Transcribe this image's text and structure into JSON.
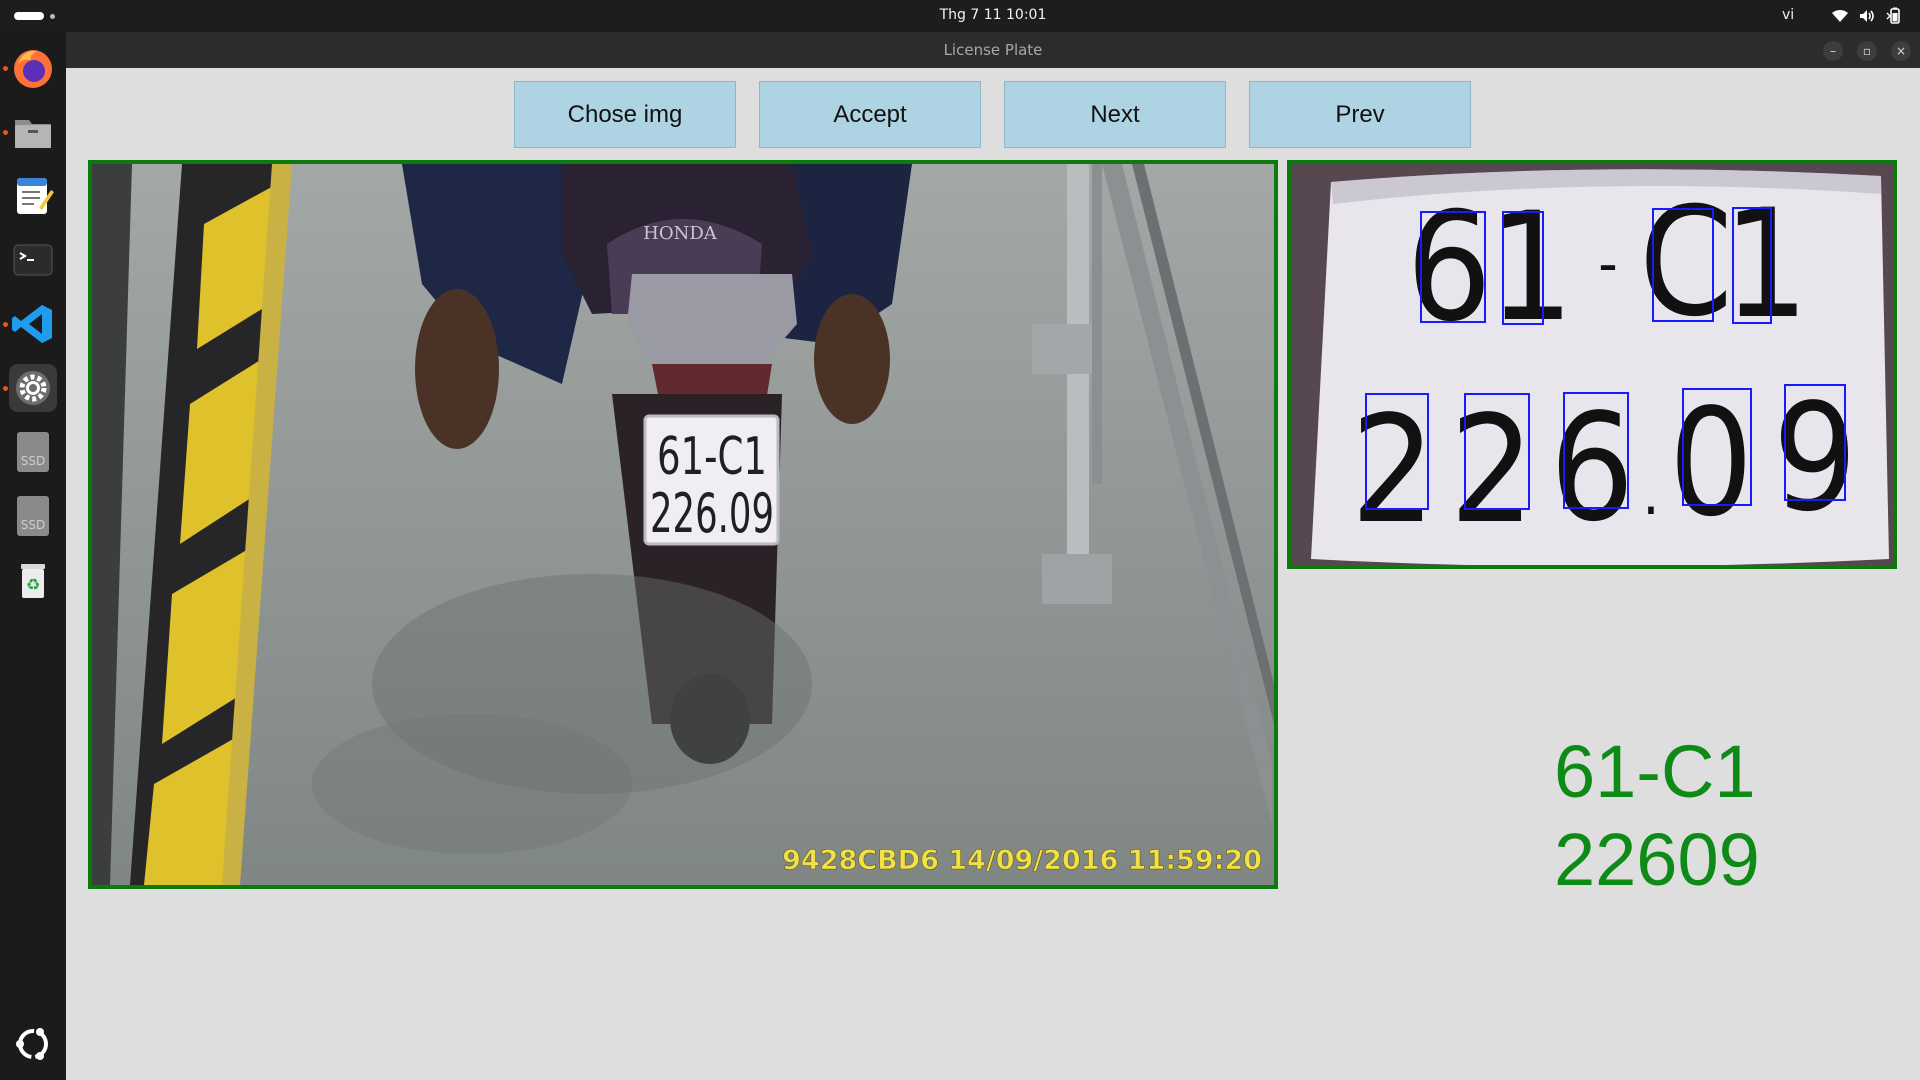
{
  "topbar": {
    "clock": "Thg 7 11  10:01",
    "language": "vi",
    "icons": [
      "wifi-icon",
      "volume-icon",
      "battery-icon"
    ]
  },
  "dock": {
    "items": [
      {
        "name": "firefox-icon",
        "running": true
      },
      {
        "name": "files-icon",
        "running": true
      },
      {
        "name": "text-editor-icon",
        "running": false
      },
      {
        "name": "terminal-icon",
        "running": false
      },
      {
        "name": "vscode-icon",
        "running": true
      },
      {
        "name": "settings-icon",
        "running": true,
        "active": true
      },
      {
        "name": "ssd-drive-icon",
        "label": "SSD"
      },
      {
        "name": "ssd-drive-icon",
        "label": "SSD"
      },
      {
        "name": "trash-icon"
      },
      {
        "name": "ubuntu-apps-icon"
      }
    ]
  },
  "window": {
    "title": "License Plate",
    "controls": {
      "minimize": "–",
      "maximize": "▫",
      "close": "×"
    }
  },
  "toolbar": {
    "chose_img": "Chose img",
    "accept": "Accept",
    "next": "Next",
    "prev": "Prev"
  },
  "scene": {
    "plate_text_line1": "61-C1",
    "plate_text_line2": "226.09",
    "brand": "HONDA",
    "overlay": "9428CBD6   14/09/2016 11:59:20"
  },
  "plate_crop": {
    "characters_row1": [
      "6",
      "1",
      "-",
      "C",
      "1"
    ],
    "characters_row2": [
      "2",
      "2",
      "6",
      ".",
      "0",
      "9"
    ]
  },
  "result": {
    "line1": "61-C1",
    "line2": "22609"
  },
  "colors": {
    "frame_green": "#0d7a0d",
    "result_green": "#0e8a16",
    "button_blue": "#aed4e3",
    "box_blue": "#1a1aff"
  }
}
